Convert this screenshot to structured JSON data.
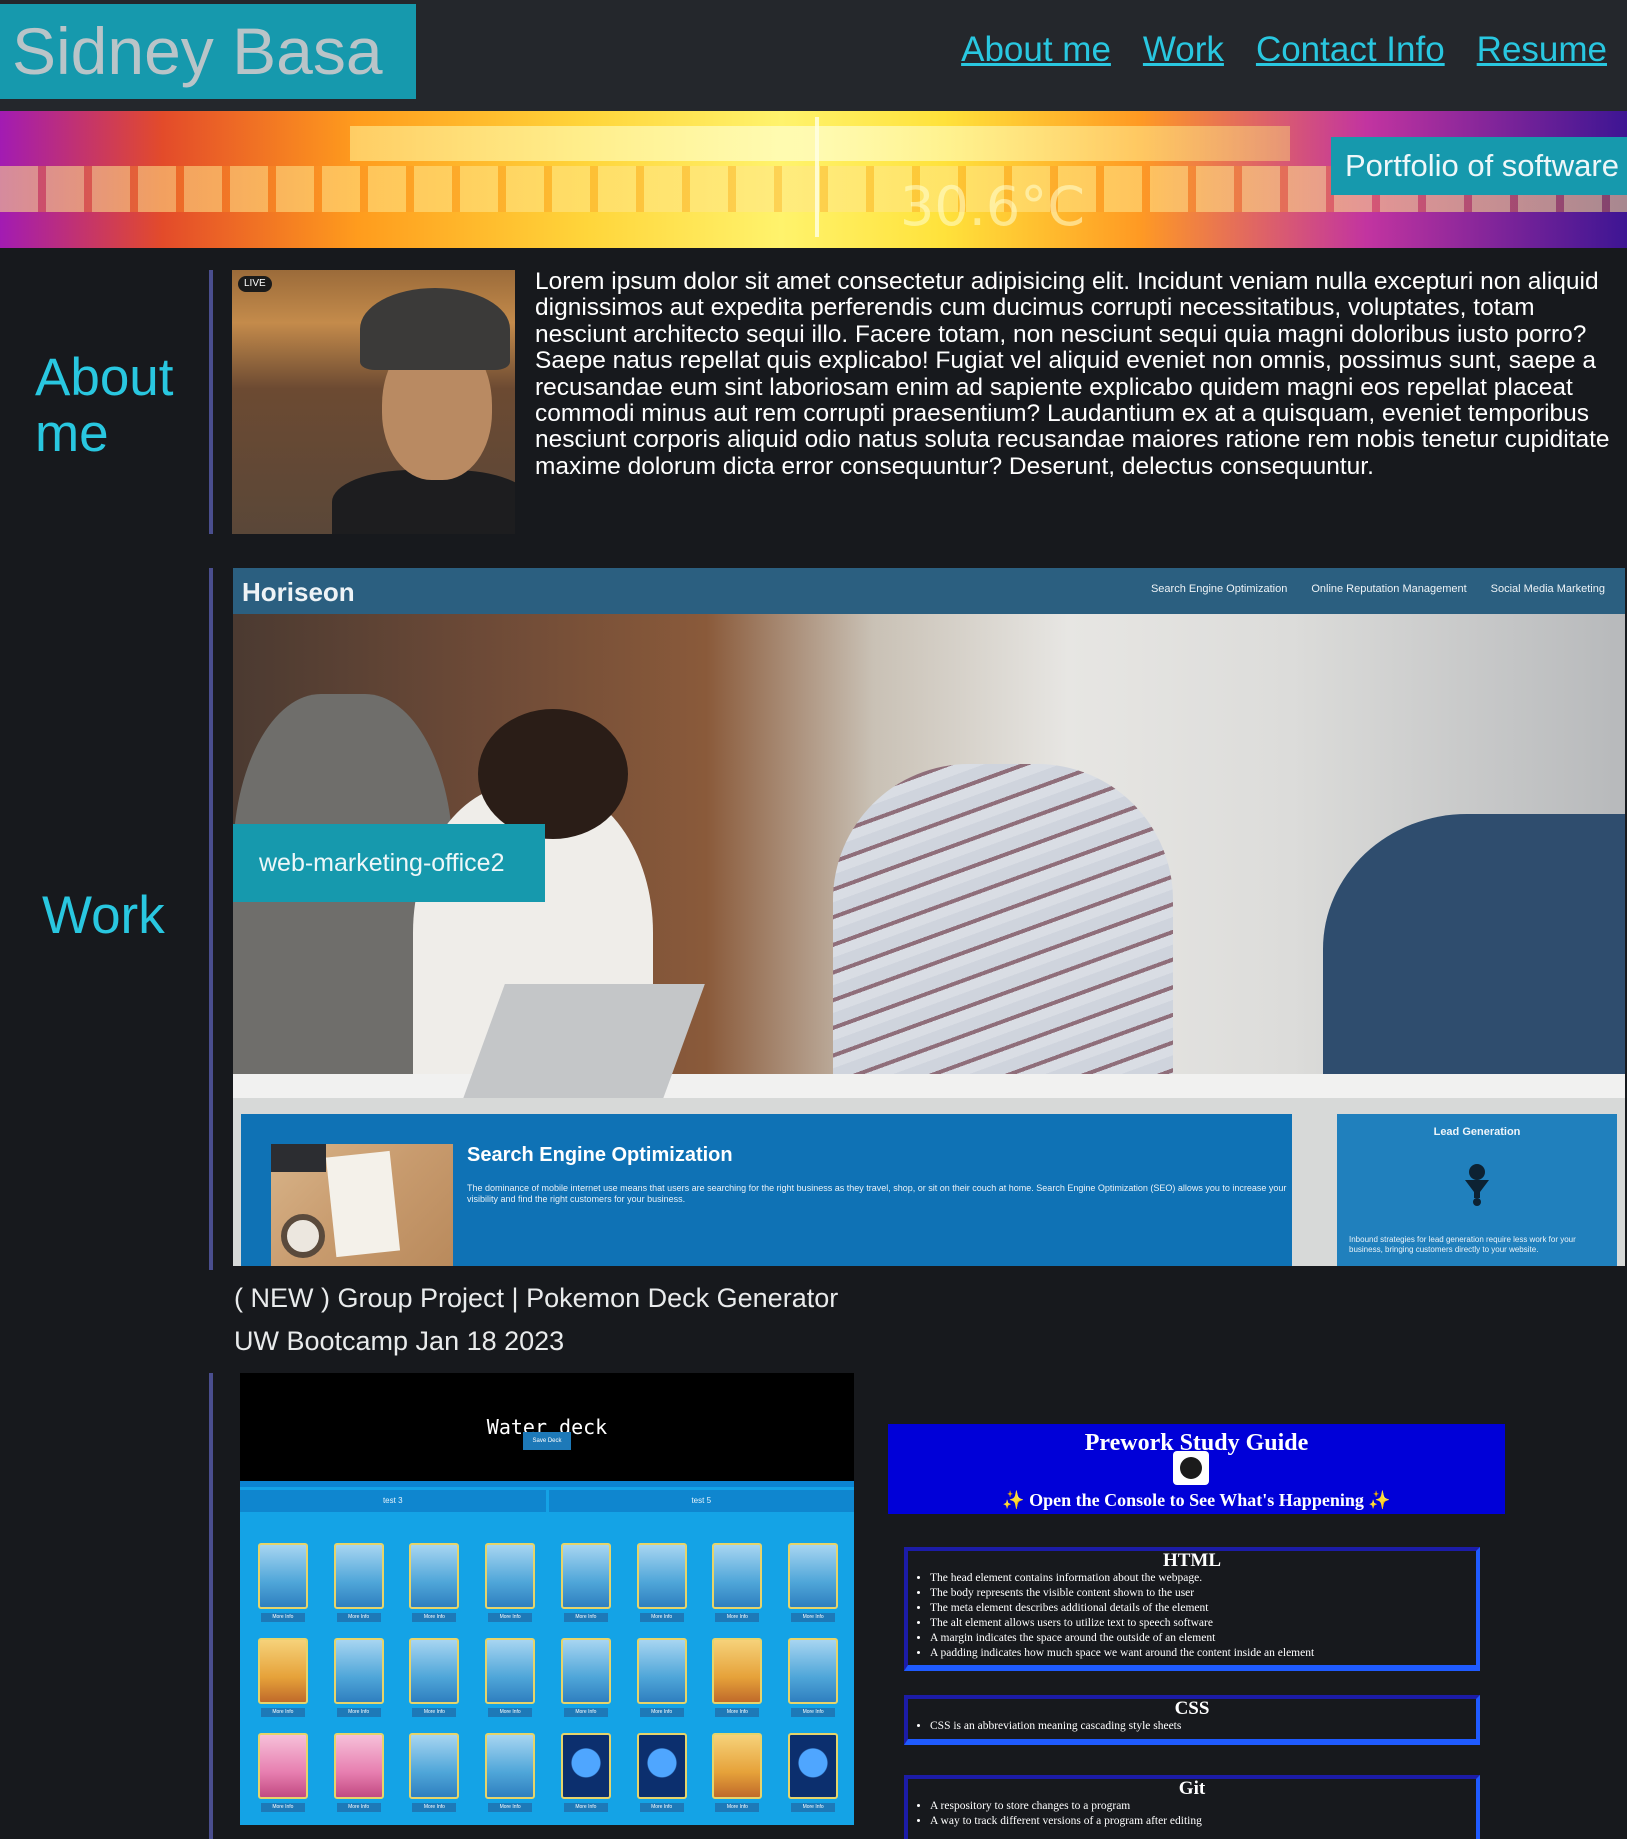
{
  "header": {
    "title": "Sidney Basa",
    "nav": [
      "About me",
      "Work",
      "Contact Info",
      "Resume"
    ]
  },
  "hero": {
    "caption": "Portfolio of software",
    "thermal_reading": "30.6°C"
  },
  "about": {
    "heading": "About me",
    "live_badge": "LIVE",
    "text": "Lorem ipsum dolor sit amet consectetur adipisicing elit. Incidunt veniam nulla excepturi non aliquid dignissimos aut expedita perferendis cum ducimus corrupti necessitatibus, voluptates, totam nesciunt architecto sequi illo. Facere totam, non nesciunt sequi quia magni doloribus iusto porro? Saepe natus repellat quis explicabo! Fugiat vel aliquid eveniet non omnis, possimus sunt, saepe a recusandae eum sint laboriosam enim ad sapiente explicabo quidem magni eos repellat placeat commodi minus aut rem corrupti praesentium? Laudantium ex at a quisquam, eveniet temporibus nesciunt corporis aliquid odio natus soluta recusandae maiores ratione rem nobis tenetur cupiditate maxime dolorum dicta error consequuntur? Deserunt, delectus consequuntur."
  },
  "work": {
    "heading": "Work",
    "horiseon": {
      "logo": "Horiseon",
      "links": [
        "Search Engine Optimization",
        "Online Reputation Management",
        "Social Media Marketing"
      ],
      "caption": "web-marketing-office2",
      "seo_title": "Search Engine Optimization",
      "seo_text": "The dominance of mobile internet use means that users are searching for the right business as they travel, shop, or sit on their couch at home. Search Engine Optimization (SEO) allows you to increase your visibility and find the right customers for your business.",
      "lead_title": "Lead Generation",
      "lead_text": "Inbound strategies for lead generation require less work for your business, bringing customers directly to your website."
    },
    "project_title": "( NEW ) Group Project | Pokemon Deck Generator",
    "project_subtitle": "UW Bootcamp Jan 18 2023",
    "deck": {
      "title": "Water deck",
      "save_label": "Save Deck",
      "tabs": [
        "test 3",
        "test 5"
      ],
      "card_button": "More Info"
    },
    "study_guide": {
      "title": "Prework Study Guide",
      "console": "✨ Open the Console to See What's Happening ✨",
      "html_heading": "HTML",
      "html_items": [
        "The head element contains information about the webpage.",
        "The body represents the visible content shown to the user",
        "The meta element describes additional details of the element",
        "The alt element allows users to utilize text to speech software",
        "A margin indicates the space around the outside of an element",
        "A padding indicates how much space we want around the content inside an element"
      ],
      "css_heading": "CSS",
      "css_items": [
        "CSS is an abbreviation meaning cascading style sheets"
      ],
      "git_heading": "Git",
      "git_items": [
        "A respository to store changes to a program",
        "A way to track different versions of a program after editing"
      ]
    }
  }
}
